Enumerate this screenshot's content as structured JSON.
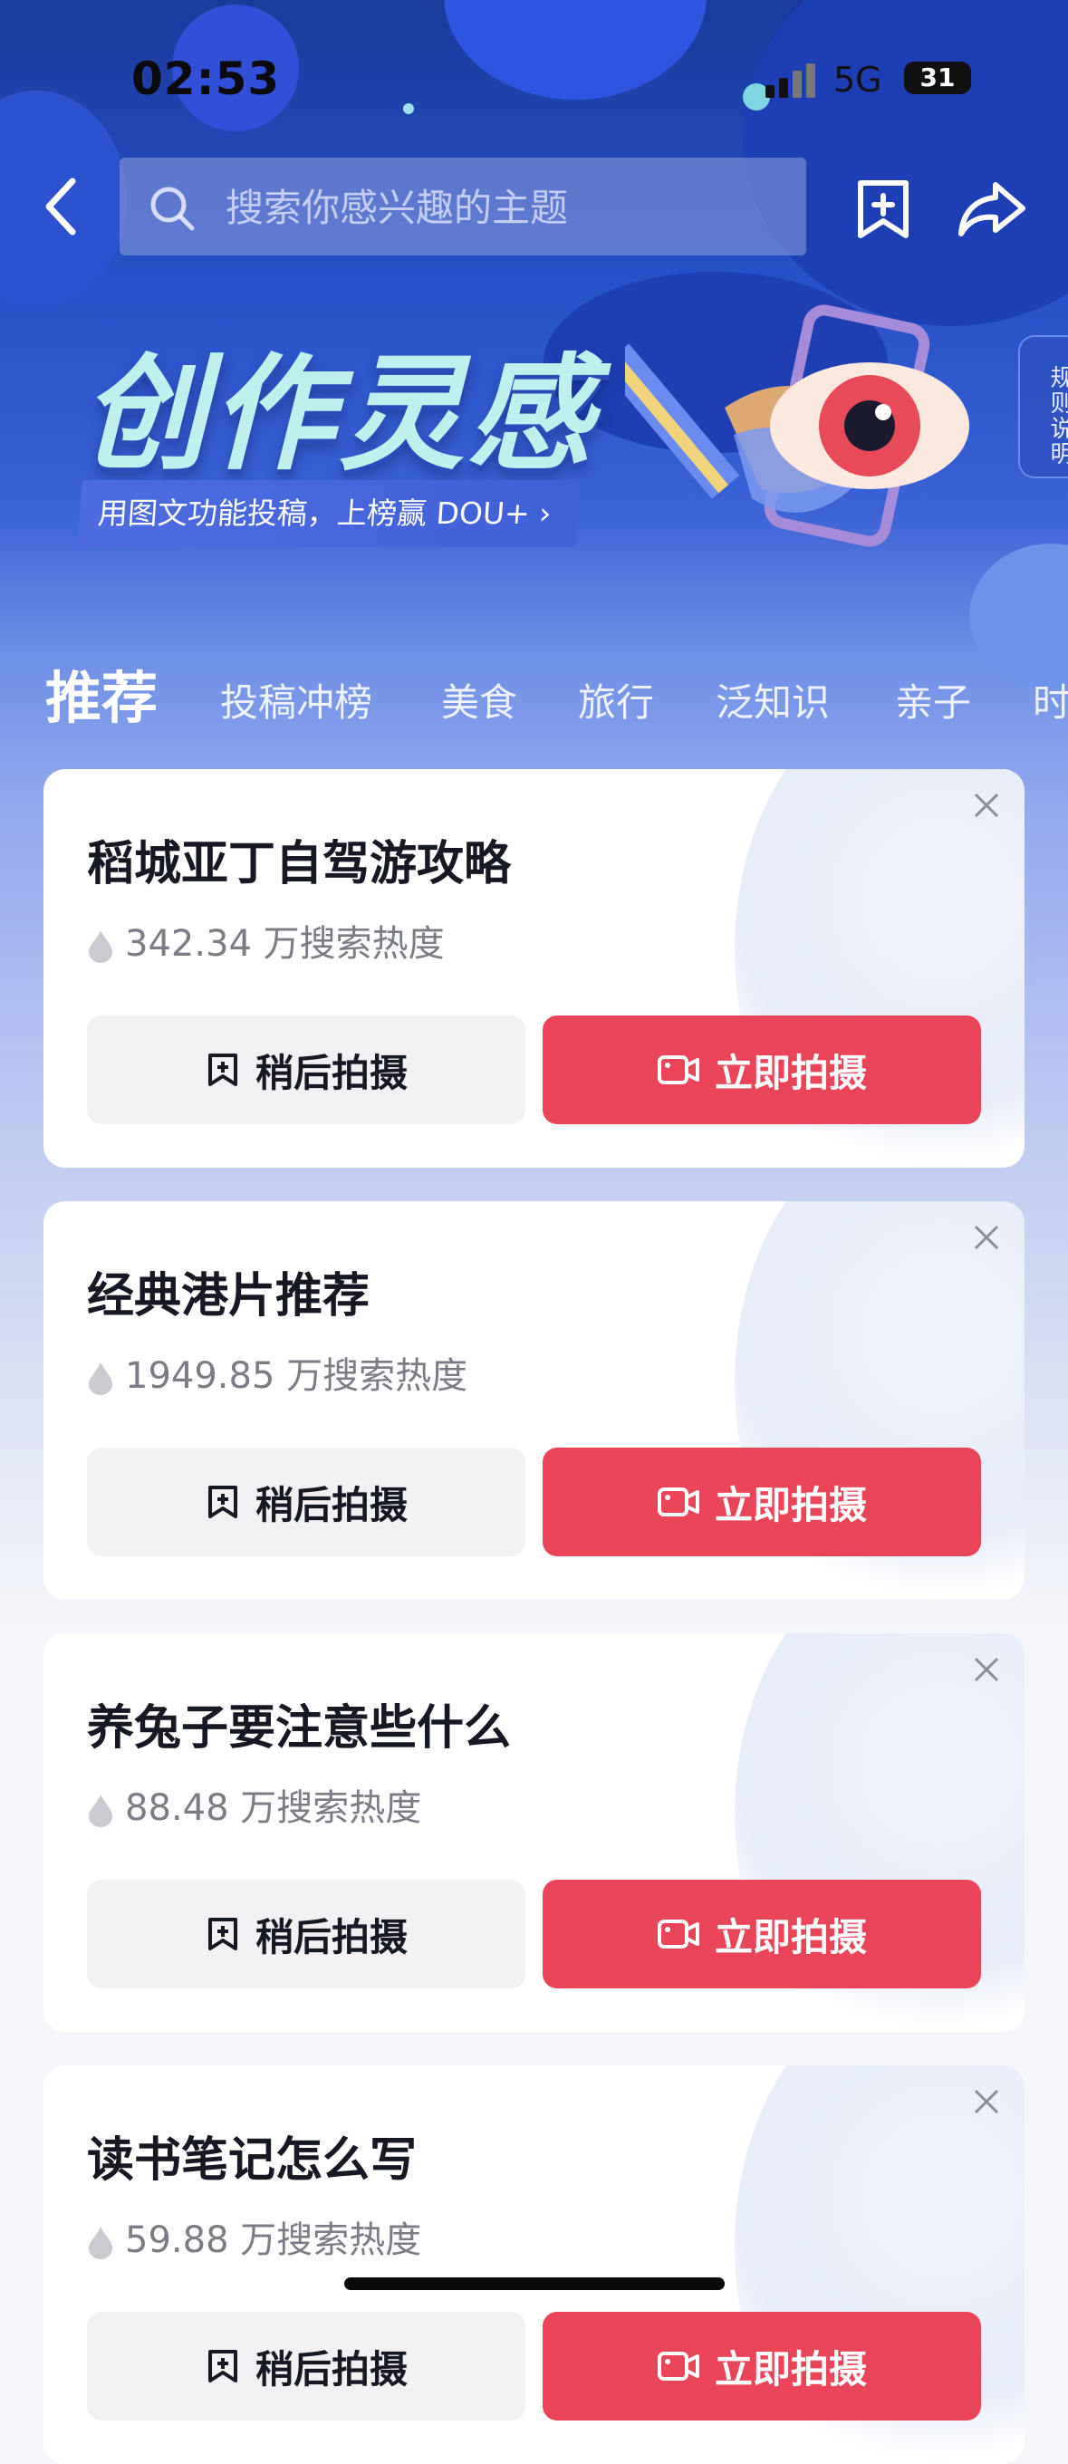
{
  "status_bar": {
    "time": "02:53",
    "network": "5G",
    "battery": "31"
  },
  "header": {
    "search_placeholder": "搜索你感兴趣的主题"
  },
  "banner": {
    "title": "创作灵感",
    "subtitle": "用图文功能投稿，上榜赢 DOU+ ›",
    "rules_label": "规则说明"
  },
  "tabs": [
    "推荐",
    "投稿冲榜",
    "美食",
    "旅行",
    "泛知识",
    "亲子",
    "时"
  ],
  "cards": [
    {
      "title": "稻城亚丁自驾游攻略",
      "heat": "342.34 万搜索热度",
      "later_label": "稍后拍摄",
      "now_label": "立即拍摄"
    },
    {
      "title": "经典港片推荐",
      "heat": "1949.85 万搜索热度",
      "later_label": "稍后拍摄",
      "now_label": "立即拍摄"
    },
    {
      "title": "养兔子要注意些什么",
      "heat": "88.48 万搜索热度",
      "later_label": "稍后拍摄",
      "now_label": "立即拍摄"
    },
    {
      "title": "读书笔记怎么写",
      "heat": "59.88 万搜索热度",
      "later_label": "稍后拍摄",
      "now_label": "立即拍摄"
    }
  ],
  "colors": {
    "accent": "#ea4459",
    "hero_top": "#1a3a9c",
    "page_bg": "#f5f6fa"
  }
}
